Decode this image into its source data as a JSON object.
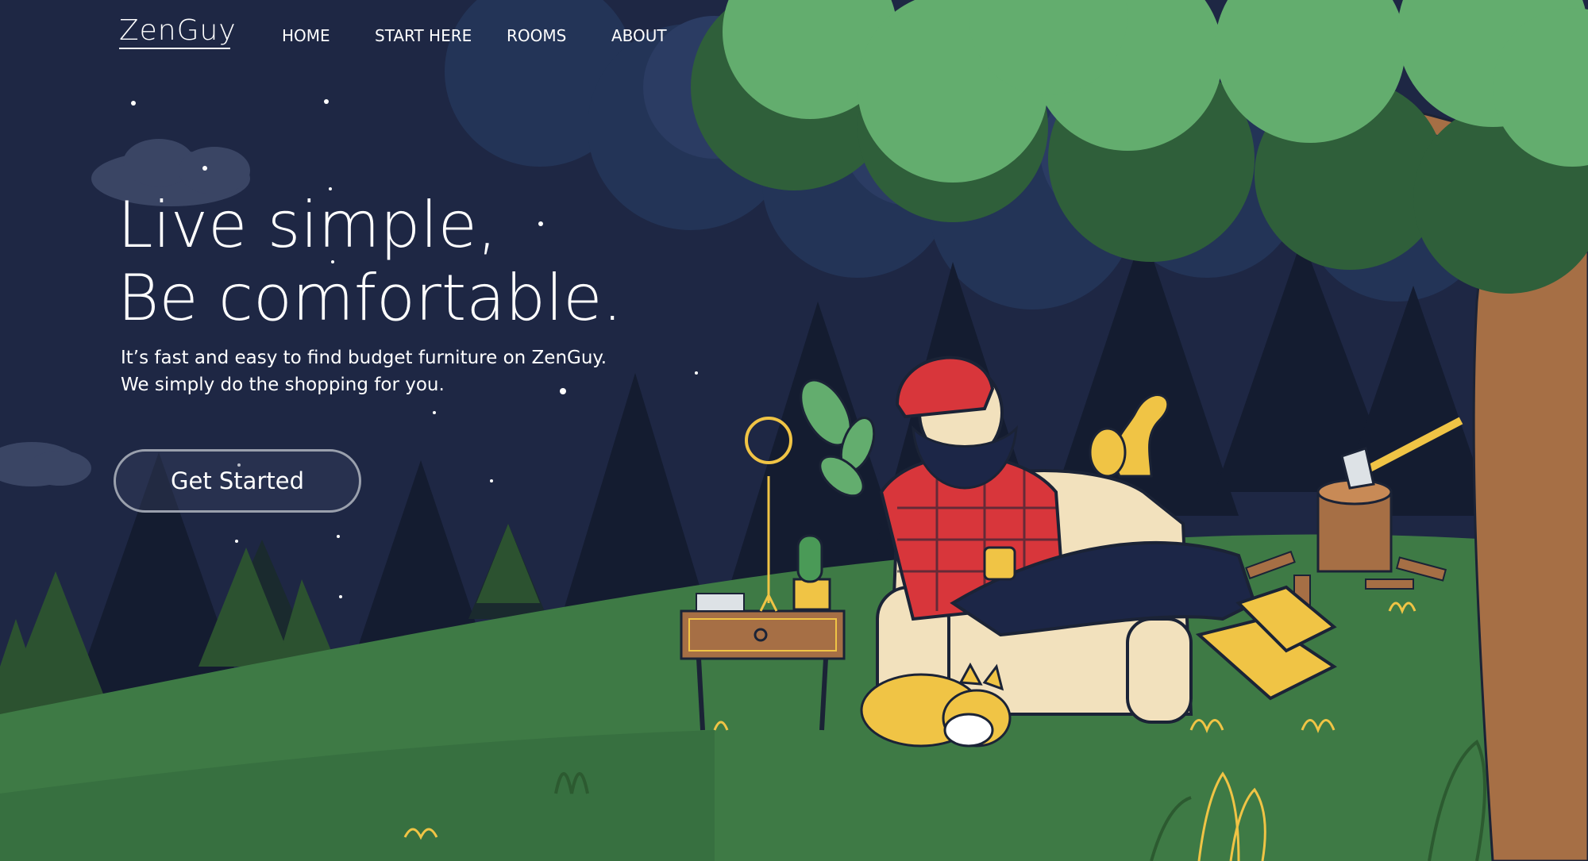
{
  "brand": {
    "logo_text": "ZenGuy"
  },
  "nav": {
    "items": [
      {
        "label": "HOME"
      },
      {
        "label": "START HERE"
      },
      {
        "label": "ROOMS"
      },
      {
        "label": "ABOUT"
      }
    ]
  },
  "hero": {
    "title_line1": "Live simple,",
    "title_line2": "Be comfortable.",
    "subtitle_line1": "It’s fast and easy to find budget furniture on ZenGuy.",
    "subtitle_line2": "We simply do the shopping for you.",
    "cta_label": "Get Started"
  },
  "colors": {
    "night_sky": "#1e2744",
    "forest_dark": "#131d31",
    "hill_green": "#3e7a45",
    "tree_canopy": "#63ad6e",
    "trunk": "#a66f45",
    "accent_yellow": "#f0c445",
    "shirt_red": "#d8363b"
  },
  "illustration": {
    "name": "lumberjack-relaxing-in-armchair",
    "elements": [
      "armchair",
      "lumberjack",
      "squirrel",
      "sleeping-fox",
      "side-table",
      "lamp",
      "cactus",
      "books",
      "tree-stump",
      "axe",
      "oak-tree",
      "pine-forest",
      "stars"
    ]
  }
}
